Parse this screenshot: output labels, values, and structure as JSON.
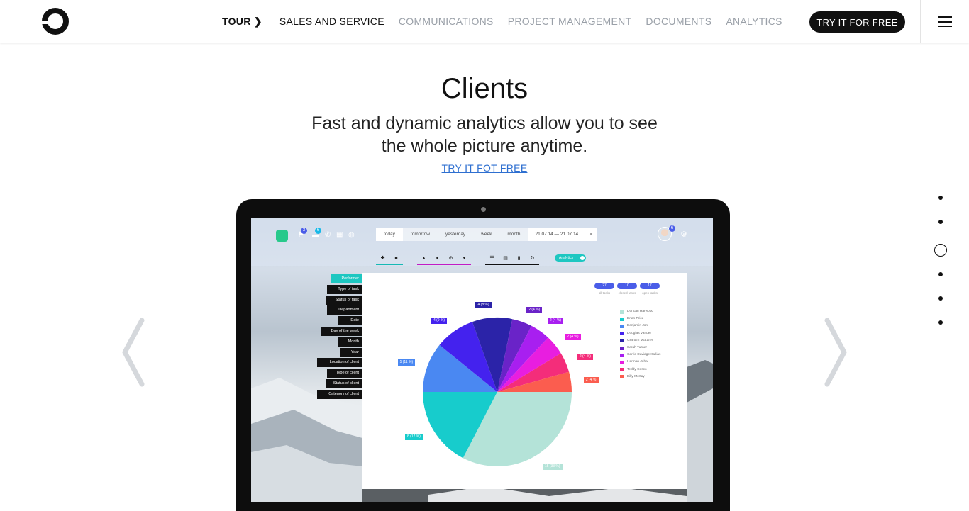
{
  "nav": {
    "tour": "TOUR ❯",
    "items": [
      {
        "label": "SALES AND SERVICE",
        "active": true
      },
      {
        "label": "COMMUNICATIONS",
        "active": false
      },
      {
        "label": "PROJECT MANAGEMENT",
        "active": false
      },
      {
        "label": "DOCUMENTS",
        "active": false
      },
      {
        "label": "ANALYTICS",
        "active": false
      }
    ],
    "cta": "TRY IT FOR FREE",
    "menu_icon": "hamburger-icon",
    "logo_icon": "ring-logo"
  },
  "hero": {
    "title": "Clients",
    "subtitle_line1": "Fast and dynamic analytics allow you to see",
    "subtitle_line2": "the whole picture anytime.",
    "link": "TRY IT FOT FREE"
  },
  "slider": {
    "dots_count": 6,
    "active_dot": 3,
    "prev_icon": "chevron-left-icon",
    "next_icon": "chevron-right-icon"
  },
  "app": {
    "badges": [
      "3",
      "6"
    ],
    "avatar_badge": "6",
    "periods": [
      "today",
      "tomorrow",
      "yesterday",
      "week",
      "month"
    ],
    "selected_period": "today",
    "date_range": "21.07.14 — 21.07.14",
    "toggle_label": "Analytics",
    "filters": [
      "Performer",
      "Type of task",
      "Status of task",
      "Department",
      "Date",
      "Day of the week",
      "Month",
      "Year",
      "Location of client",
      "Type of client",
      "Status of client",
      "Category of client"
    ],
    "selected_filter": "Performer",
    "counts": [
      {
        "value": "27",
        "label": "all tasks"
      },
      {
        "value": "10",
        "label": "closed tasks"
      },
      {
        "value": "17",
        "label": "open tasks"
      }
    ]
  },
  "chart_data": {
    "type": "pie",
    "title": "",
    "slices": [
      {
        "name": "Duncan Harwood",
        "value": 15,
        "label": "15 (33 %)",
        "color": "#b4e3d8"
      },
      {
        "name": "Brian Price",
        "value": 8,
        "label": "8 (17 %)",
        "color": "#17cccc"
      },
      {
        "name": "Benjamin Jon",
        "value": 5,
        "label": "5 (11 %)",
        "color": "#4a88f2"
      },
      {
        "name": "Douglas Vander",
        "value": 4,
        "label": "4 (9 %)",
        "color": "#4422ee"
      },
      {
        "name": "Graham McLaren",
        "value": 4,
        "label": "4 (8 %)",
        "color": "#2b23a8"
      },
      {
        "name": "Sarah Turner",
        "value": 2,
        "label": "2 (4 %)",
        "color": "#6a23c8"
      },
      {
        "name": "Carrie Davidge Kallias",
        "value": 2,
        "label": "2 (4 %)",
        "color": "#a81ff0"
      },
      {
        "name": "Herman Johal",
        "value": 2,
        "label": "2 (4 %)",
        "color": "#e81ee0"
      },
      {
        "name": "Teddy Cosco",
        "value": 2,
        "label": "2 (4 %)",
        "color": "#f42d7a"
      },
      {
        "name": "Billy McKay",
        "value": 2,
        "label": "2 (4 %)",
        "color": "#fb5d4f"
      }
    ]
  }
}
